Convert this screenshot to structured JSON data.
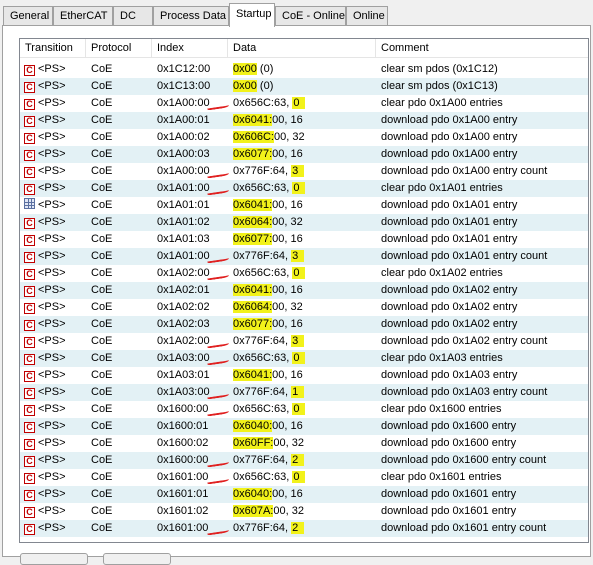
{
  "tabs": [
    {
      "label": "General",
      "active": false
    },
    {
      "label": "EtherCAT",
      "active": false
    },
    {
      "label": "DC",
      "active": false
    },
    {
      "label": "Process Data",
      "active": false
    },
    {
      "label": "Startup",
      "active": true
    },
    {
      "label": "CoE - Online",
      "active": false
    },
    {
      "label": "Online",
      "active": false
    }
  ],
  "columns": {
    "transition": "Transition",
    "protocol": "Protocol",
    "index": "Index",
    "data": "Data",
    "comment": "Comment"
  },
  "colors": {
    "highlight": "#f2f21a",
    "annotation_red": "#e02020",
    "row_alt": "#e3f1f5",
    "icon_red": "#c00000"
  },
  "rows": [
    {
      "icon": "c",
      "transition": "<PS>",
      "protocol": "CoE",
      "index": "0x1C12:00",
      "data_hl": "0x00",
      "data_rest": " (0)",
      "comment": "clear sm pdos (0x1C12)",
      "mark": false
    },
    {
      "icon": "c",
      "transition": "<PS>",
      "protocol": "CoE",
      "index": "0x1C13:00",
      "data_hl": "0x00",
      "data_rest": " (0)",
      "comment": "clear sm pdos (0x1C13)",
      "mark": false
    },
    {
      "icon": "c",
      "transition": "<PS>",
      "protocol": "CoE",
      "index": "0x1A00:00",
      "data_pre": "0x656C:63, ",
      "data_hl2": "0",
      "comment": "clear pdo 0x1A00 entries",
      "mark": true
    },
    {
      "icon": "c",
      "transition": "<PS>",
      "protocol": "CoE",
      "index": "0x1A00:01",
      "data_hl": "0x6041:",
      "data_rest": "00, 16",
      "comment": "download pdo 0x1A00 entry",
      "mark": false
    },
    {
      "icon": "c",
      "transition": "<PS>",
      "protocol": "CoE",
      "index": "0x1A00:02",
      "data_hl": "0x606C:",
      "data_rest": "00, 32",
      "comment": "download pdo 0x1A00 entry",
      "mark": false
    },
    {
      "icon": "c",
      "transition": "<PS>",
      "protocol": "CoE",
      "index": "0x1A00:03",
      "data_hl": "0x6077:",
      "data_rest": "00, 16",
      "comment": "download pdo 0x1A00 entry",
      "mark": false
    },
    {
      "icon": "c",
      "transition": "<PS>",
      "protocol": "CoE",
      "index": "0x1A00:00",
      "data_pre": "0x776F:64, ",
      "data_hl2": "3",
      "comment": "download pdo 0x1A00 entry count",
      "mark": true
    },
    {
      "icon": "c",
      "transition": "<PS>",
      "protocol": "CoE",
      "index": "0x1A01:00",
      "data_pre": "0x656C:63, ",
      "data_hl2": "0",
      "comment": "clear pdo 0x1A01 entries",
      "mark": true
    },
    {
      "icon": "grid",
      "transition": "<PS>",
      "protocol": "CoE",
      "index": "0x1A01:01",
      "data_hl": "0x6041:",
      "data_rest": "00, 16",
      "comment": "download pdo 0x1A01 entry",
      "mark": false
    },
    {
      "icon": "c",
      "transition": "<PS>",
      "protocol": "CoE",
      "index": "0x1A01:02",
      "data_hl": "0x6064:",
      "data_rest": "00, 32",
      "comment": "download pdo 0x1A01 entry",
      "mark": false
    },
    {
      "icon": "c",
      "transition": "<PS>",
      "protocol": "CoE",
      "index": "0x1A01:03",
      "data_hl": "0x6077:",
      "data_rest": "00, 16",
      "comment": "download pdo 0x1A01 entry",
      "mark": false
    },
    {
      "icon": "c",
      "transition": "<PS>",
      "protocol": "CoE",
      "index": "0x1A01:00",
      "data_pre": "0x776F:64, ",
      "data_hl2": "3",
      "comment": "download pdo 0x1A01 entry count",
      "mark": true
    },
    {
      "icon": "c",
      "transition": "<PS>",
      "protocol": "CoE",
      "index": "0x1A02:00",
      "data_pre": "0x656C:63, ",
      "data_hl2": "0",
      "comment": "clear pdo 0x1A02 entries",
      "mark": true
    },
    {
      "icon": "c",
      "transition": "<PS>",
      "protocol": "CoE",
      "index": "0x1A02:01",
      "data_hl": "0x6041:",
      "data_rest": "00, 16",
      "comment": "download pdo 0x1A02 entry",
      "mark": false
    },
    {
      "icon": "c",
      "transition": "<PS>",
      "protocol": "CoE",
      "index": "0x1A02:02",
      "data_hl": "0x6064:",
      "data_rest": "00, 32",
      "comment": "download pdo 0x1A02 entry",
      "mark": false
    },
    {
      "icon": "c",
      "transition": "<PS>",
      "protocol": "CoE",
      "index": "0x1A02:03",
      "data_hl": "0x6077:",
      "data_rest": "00, 16",
      "comment": "download pdo 0x1A02 entry",
      "mark": false
    },
    {
      "icon": "c",
      "transition": "<PS>",
      "protocol": "CoE",
      "index": "0x1A02:00",
      "data_pre": "0x776F:64, ",
      "data_hl2": "3",
      "comment": "download pdo 0x1A02 entry count",
      "mark": true
    },
    {
      "icon": "c",
      "transition": "<PS>",
      "protocol": "CoE",
      "index": "0x1A03:00",
      "data_pre": "0x656C:63, ",
      "data_hl2": "0",
      "comment": "clear pdo 0x1A03 entries",
      "mark": true
    },
    {
      "icon": "c",
      "transition": "<PS>",
      "protocol": "CoE",
      "index": "0x1A03:01",
      "data_hl": "0x6041:",
      "data_rest": "00, 16",
      "comment": "download pdo 0x1A03 entry",
      "mark": false
    },
    {
      "icon": "c",
      "transition": "<PS>",
      "protocol": "CoE",
      "index": "0x1A03:00",
      "data_pre": "0x776F:64, ",
      "data_hl2": "1",
      "comment": "download pdo 0x1A03 entry count",
      "mark": true
    },
    {
      "icon": "c",
      "transition": "<PS>",
      "protocol": "CoE",
      "index": "0x1600:00",
      "data_pre": "0x656C:63, ",
      "data_hl2": "0",
      "comment": "clear pdo 0x1600 entries",
      "mark": true
    },
    {
      "icon": "c",
      "transition": "<PS>",
      "protocol": "CoE",
      "index": "0x1600:01",
      "data_hl": "0x6040:",
      "data_rest": "00, 16",
      "comment": "download pdo 0x1600 entry",
      "mark": false
    },
    {
      "icon": "c",
      "transition": "<PS>",
      "protocol": "CoE",
      "index": "0x1600:02",
      "data_hl": "0x60FF:",
      "data_rest": "00, 32",
      "comment": "download pdo 0x1600 entry",
      "mark": false
    },
    {
      "icon": "c",
      "transition": "<PS>",
      "protocol": "CoE",
      "index": "0x1600:00",
      "data_pre": "0x776F:64, ",
      "data_hl2": "2",
      "comment": "download pdo 0x1600 entry count",
      "mark": true
    },
    {
      "icon": "c",
      "transition": "<PS>",
      "protocol": "CoE",
      "index": "0x1601:00",
      "data_pre": "0x656C:63, ",
      "data_hl2": "0",
      "comment": "clear pdo 0x1601 entries",
      "mark": true
    },
    {
      "icon": "c",
      "transition": "<PS>",
      "protocol": "CoE",
      "index": "0x1601:01",
      "data_hl": "0x6040:",
      "data_rest": "00, 16",
      "comment": "download pdo 0x1601 entry",
      "mark": false
    },
    {
      "icon": "c",
      "transition": "<PS>",
      "protocol": "CoE",
      "index": "0x1601:02",
      "data_hl": "0x607A:",
      "data_rest": "00, 32",
      "comment": "download pdo 0x1601 entry",
      "mark": false
    },
    {
      "icon": "c",
      "transition": "<PS>",
      "protocol": "CoE",
      "index": "0x1601:00",
      "data_pre": "0x776F:64, ",
      "data_hl2": "2",
      "comment": "download pdo 0x1601 entry count",
      "mark": true
    }
  ]
}
